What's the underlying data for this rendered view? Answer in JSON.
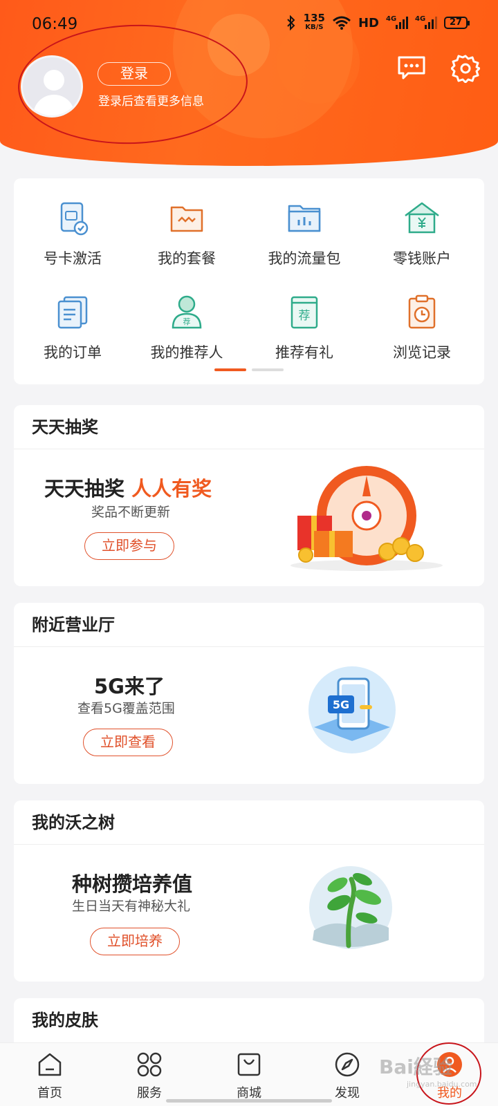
{
  "status_bar": {
    "time": "06:49",
    "speed_value": "135",
    "speed_unit": "KB/S",
    "hd": "HD",
    "net1": "4G",
    "net2": "4G",
    "battery": "27"
  },
  "profile": {
    "login_label": "登录",
    "login_hint": "登录后查看更多信息"
  },
  "quick_grid": {
    "items": [
      {
        "label": "号卡激活",
        "icon": "sim-card-activate-icon"
      },
      {
        "label": "我的套餐",
        "icon": "package-folder-icon"
      },
      {
        "label": "我的流量包",
        "icon": "data-pack-icon"
      },
      {
        "label": "零钱账户",
        "icon": "wallet-house-icon"
      },
      {
        "label": "我的订单",
        "icon": "order-list-icon"
      },
      {
        "label": "我的推荐人",
        "icon": "referrer-person-icon"
      },
      {
        "label": "推荐有礼",
        "icon": "recommend-gift-icon"
      },
      {
        "label": "浏览记录",
        "icon": "history-clipboard-icon"
      }
    ],
    "page_count": 2,
    "active_page": 1
  },
  "sections": {
    "lottery": {
      "title": "天天抽奖",
      "headline": "天天抽奖",
      "headline_accent": "人人有奖",
      "sub": "奖品不断更新",
      "button": "立即参与"
    },
    "store": {
      "title": "附近营业厅",
      "headline": "5G来了",
      "sub": "查看5G覆盖范围",
      "button": "立即查看",
      "badge": "5G"
    },
    "tree": {
      "title": "我的沃之树",
      "headline": "种树攒培养值",
      "sub": "生日当天有神秘大礼",
      "button": "立即培养"
    },
    "skin": {
      "title": "我的皮肤"
    }
  },
  "bottom_nav": {
    "items": [
      {
        "label": "首页",
        "icon": "home-icon"
      },
      {
        "label": "服务",
        "icon": "services-grid-icon"
      },
      {
        "label": "商城",
        "icon": "shopping-bag-icon"
      },
      {
        "label": "发现",
        "icon": "compass-icon"
      },
      {
        "label": "我的",
        "icon": "my-profile-icon"
      }
    ],
    "active_index": 4
  },
  "watermark": {
    "main": "Bai経验",
    "sub": "jingyan.baidu.com"
  },
  "colors": {
    "brand_orange": "#ff5d14",
    "accent": "#f05a20",
    "annotation_red": "#c8151b"
  }
}
